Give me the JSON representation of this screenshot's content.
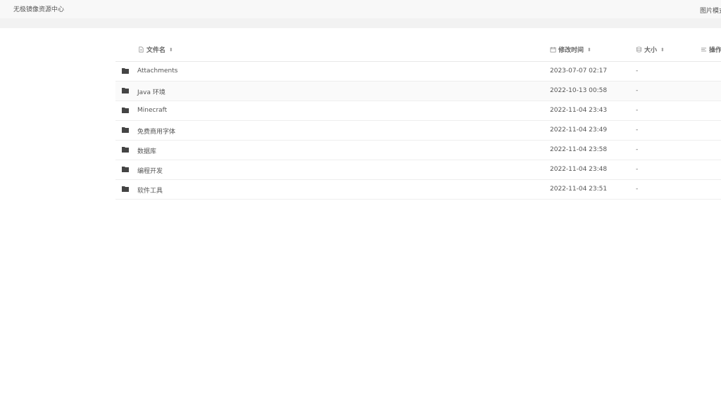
{
  "header": {
    "site_title": "无极镜像资源中心",
    "right_link": "图片模式"
  },
  "table": {
    "columns": {
      "name": "文件名",
      "modified": "修改时间",
      "size": "大小",
      "action": "操作"
    },
    "rows": [
      {
        "icon": "folder-icon",
        "name": "Attachments",
        "modified": "2023-07-07 02:17",
        "size": "-"
      },
      {
        "icon": "folder-icon",
        "name": "Java 环境",
        "modified": "2022-10-13 00:58",
        "size": "-"
      },
      {
        "icon": "folder-icon",
        "name": "Minecraft",
        "modified": "2022-11-04 23:43",
        "size": "-"
      },
      {
        "icon": "folder-icon",
        "name": "免费商用字体",
        "modified": "2022-11-04 23:49",
        "size": "-"
      },
      {
        "icon": "folder-icon",
        "name": "数据库",
        "modified": "2022-11-04 23:58",
        "size": "-"
      },
      {
        "icon": "folder-icon",
        "name": "编程开发",
        "modified": "2022-11-04 23:48",
        "size": "-"
      },
      {
        "icon": "folder-icon",
        "name": "软件工具",
        "modified": "2022-11-04 23:51",
        "size": "-"
      }
    ]
  }
}
